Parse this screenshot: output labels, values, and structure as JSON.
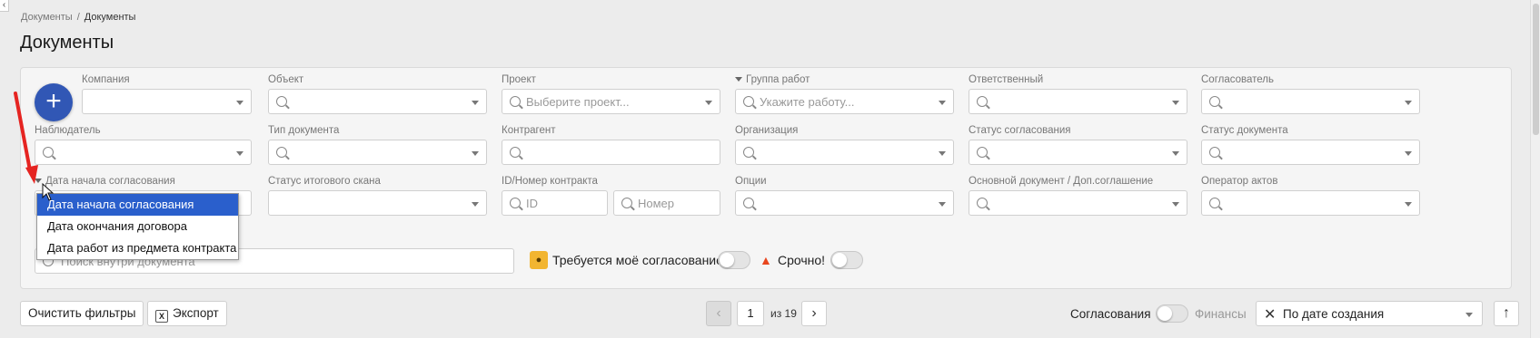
{
  "breadcrumb": {
    "root": "Документы",
    "sep": "/",
    "current": "Документы"
  },
  "page_title": "Документы",
  "filters": {
    "company": {
      "label": "Компания",
      "value": ""
    },
    "object": {
      "label": "Объект",
      "value": ""
    },
    "project": {
      "label": "Проект",
      "placeholder": "Выберите проект..."
    },
    "work_group": {
      "label": "Группа работ",
      "placeholder": "Укажите работу..."
    },
    "responsible": {
      "label": "Ответственный",
      "value": ""
    },
    "approver": {
      "label": "Согласователь",
      "value": ""
    },
    "observer": {
      "label": "Наблюдатель",
      "value": ""
    },
    "doc_type": {
      "label": "Тип документа",
      "value": ""
    },
    "counterparty": {
      "label": "Контрагент",
      "value": ""
    },
    "organization": {
      "label": "Организация",
      "value": ""
    },
    "approval_status": {
      "label": "Статус согласования",
      "value": ""
    },
    "doc_status": {
      "label": "Статус документа",
      "value": ""
    },
    "date_filter": {
      "label": "Дата начала согласования"
    },
    "final_scan_status": {
      "label": "Статус итогового скана",
      "value": ""
    },
    "contract_id": {
      "label": "ID/Номер контракта",
      "id_placeholder": "ID",
      "number_placeholder": "Номер"
    },
    "options": {
      "label": "Опции",
      "value": ""
    },
    "main_doc": {
      "label": "Основной документ / Доп.соглашение",
      "value": ""
    },
    "act_operator": {
      "label": "Оператор актов",
      "value": ""
    },
    "search": {
      "placeholder": "Поиск внутри документа"
    }
  },
  "toggles": {
    "my_approval": {
      "label": "Требуется моё согласование",
      "on": false
    },
    "urgent": {
      "label": "Срочно!",
      "on": false
    }
  },
  "date_dropdown": {
    "options": [
      "Дата начала согласования",
      "Дата окончания договора",
      "Дата работ из предмета контракта"
    ],
    "selected_index": 0
  },
  "toolbar": {
    "clear_filters": "Очистить фильтры",
    "export": "Экспорт",
    "excel_glyph": "X"
  },
  "pagination": {
    "page": "1",
    "of_text": "из 19",
    "prev_icon": "‹",
    "next_icon": "›"
  },
  "view_switch": {
    "left": "Согласования",
    "right": "Финансы"
  },
  "sort": {
    "value": "По дате создания",
    "clear_icon": "✕"
  },
  "up_icon": "↑",
  "add_icon": "+",
  "collapse_icon": "‹",
  "colors": {
    "accent": "#3157b5",
    "selected_option": "#2a5fcc",
    "annotation_arrow": "#e52421",
    "urgent": "#e8461e",
    "approve_badge": "#f2b530"
  }
}
